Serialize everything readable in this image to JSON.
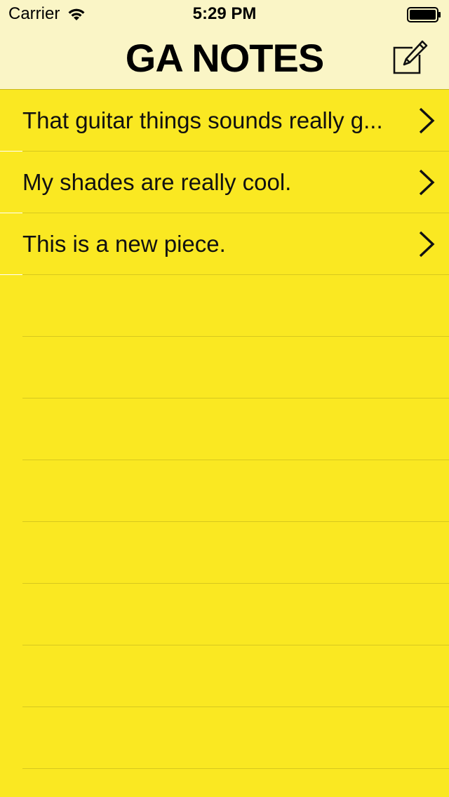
{
  "status_bar": {
    "carrier": "Carrier",
    "time": "5:29 PM"
  },
  "nav": {
    "title": "GA NOTES",
    "compose_icon": "compose-icon"
  },
  "notes": [
    {
      "title": "That guitar things sounds really g..."
    },
    {
      "title": "My shades are really cool."
    },
    {
      "title": "This is a new piece."
    }
  ],
  "colors": {
    "background": "#FAE822",
    "header": "#FAF5C6",
    "separator": "#D7C81E",
    "text": "#111111"
  }
}
